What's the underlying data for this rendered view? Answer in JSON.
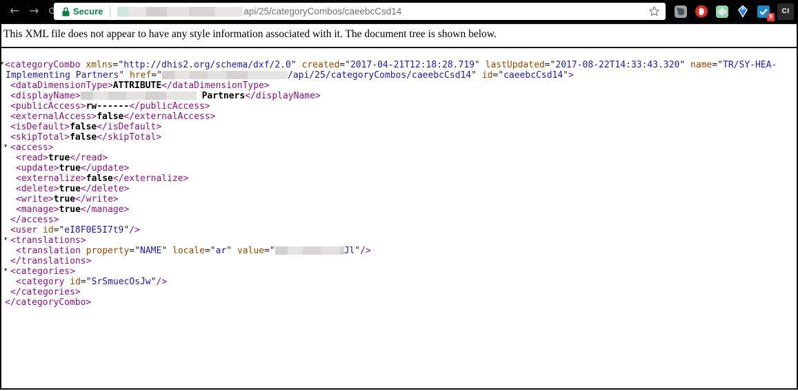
{
  "colors": {
    "tag": "#881280",
    "attr": "#994500",
    "value": "#1a1aa6",
    "green": "#0b8043",
    "red": "#e53935"
  },
  "browser": {
    "back_icon": "←",
    "forward_icon": "→",
    "reload_icon": "⟳",
    "security_label": "Secure",
    "url_path": "api/25/categoryCombos/caeebcCsd14",
    "star_icon": "bookmark-star",
    "extensions": [
      "evernote",
      "stop-hand",
      "audio-wave",
      "gem",
      "check-tasks"
    ],
    "notification_badge": "9",
    "profile_label": "CI"
  },
  "notice": "This XML file does not appear to have any style information associated with it. The document tree is shown below.",
  "xml": {
    "lines": [
      {
        "indent": 0,
        "arrow": true,
        "seg": [
          [
            "g",
            "<categoryCombo "
          ],
          [
            "a",
            "xmlns"
          ],
          [
            "p",
            "=\""
          ],
          [
            "v",
            "http://dhis2.org/schema/dxf/2.0"
          ],
          [
            "p",
            "\" "
          ],
          [
            "a",
            "created"
          ],
          [
            "p",
            "=\""
          ],
          [
            "v",
            "2017-04-21T12:18:28.719"
          ],
          [
            "p",
            "\" "
          ],
          [
            "a",
            "lastUpdated"
          ],
          [
            "p",
            "=\""
          ],
          [
            "v",
            "2017-08-22T14:33:43.320"
          ],
          [
            "p",
            "\" "
          ],
          [
            "a",
            "name"
          ],
          [
            "p",
            "=\""
          ],
          [
            "v",
            "TR/SY-HEA-"
          ]
        ]
      },
      {
        "indent": 0,
        "cont": true,
        "seg": [
          [
            "v",
            "Implementing Partners"
          ],
          [
            "p",
            "\" "
          ],
          [
            "a",
            "href"
          ],
          [
            "p",
            "=\""
          ],
          [
            "b",
            "182"
          ],
          [
            "v",
            "/api/25/categoryCombos/caeebcCsd14"
          ],
          [
            "p",
            "\" "
          ],
          [
            "a",
            "id"
          ],
          [
            "p",
            "=\""
          ],
          [
            "v",
            "caeebcCsd14"
          ],
          [
            "p",
            "\""
          ],
          [
            "g",
            ">"
          ]
        ]
      },
      {
        "indent": 1,
        "seg": [
          [
            "g",
            "<dataDimensionType>"
          ],
          [
            "x",
            "ATTRIBUTE"
          ],
          [
            "g",
            "</dataDimensionType>"
          ]
        ]
      },
      {
        "indent": 1,
        "seg": [
          [
            "g",
            "<displayName>"
          ],
          [
            "b",
            "168"
          ],
          [
            "x",
            " Partners"
          ],
          [
            "g",
            "</displayName>"
          ]
        ]
      },
      {
        "indent": 1,
        "seg": [
          [
            "g",
            "<publicAccess>"
          ],
          [
            "x",
            "rw------"
          ],
          [
            "g",
            "</publicAccess>"
          ]
        ]
      },
      {
        "indent": 1,
        "seg": [
          [
            "g",
            "<externalAccess>"
          ],
          [
            "x",
            "false"
          ],
          [
            "g",
            "</externalAccess>"
          ]
        ]
      },
      {
        "indent": 1,
        "seg": [
          [
            "g",
            "<isDefault>"
          ],
          [
            "x",
            "false"
          ],
          [
            "g",
            "</isDefault>"
          ]
        ]
      },
      {
        "indent": 1,
        "seg": [
          [
            "g",
            "<skipTotal>"
          ],
          [
            "x",
            "false"
          ],
          [
            "g",
            "</skipTotal>"
          ]
        ]
      },
      {
        "indent": 1,
        "arrow": true,
        "seg": [
          [
            "g",
            "<access>"
          ]
        ]
      },
      {
        "indent": 2,
        "seg": [
          [
            "g",
            "<read>"
          ],
          [
            "x",
            "true"
          ],
          [
            "g",
            "</read>"
          ]
        ]
      },
      {
        "indent": 2,
        "seg": [
          [
            "g",
            "<update>"
          ],
          [
            "x",
            "true"
          ],
          [
            "g",
            "</update>"
          ]
        ]
      },
      {
        "indent": 2,
        "seg": [
          [
            "g",
            "<externalize>"
          ],
          [
            "x",
            "false"
          ],
          [
            "g",
            "</externalize>"
          ]
        ]
      },
      {
        "indent": 2,
        "seg": [
          [
            "g",
            "<delete>"
          ],
          [
            "x",
            "true"
          ],
          [
            "g",
            "</delete>"
          ]
        ]
      },
      {
        "indent": 2,
        "seg": [
          [
            "g",
            "<write>"
          ],
          [
            "x",
            "true"
          ],
          [
            "g",
            "</write>"
          ]
        ]
      },
      {
        "indent": 2,
        "seg": [
          [
            "g",
            "<manage>"
          ],
          [
            "x",
            "true"
          ],
          [
            "g",
            "</manage>"
          ]
        ]
      },
      {
        "indent": 1,
        "seg": [
          [
            "g",
            "</access>"
          ]
        ]
      },
      {
        "indent": 1,
        "seg": [
          [
            "g",
            "<user "
          ],
          [
            "a",
            "id"
          ],
          [
            "p",
            "=\""
          ],
          [
            "v",
            "eI8F0E5I7t9"
          ],
          [
            "p",
            "\""
          ],
          [
            "g",
            "/>"
          ]
        ]
      },
      {
        "indent": 1,
        "arrow": true,
        "seg": [
          [
            "g",
            "<translations>"
          ]
        ]
      },
      {
        "indent": 2,
        "seg": [
          [
            "g",
            "<translation "
          ],
          [
            "a",
            "property"
          ],
          [
            "p",
            "=\""
          ],
          [
            "v",
            "NAME"
          ],
          [
            "p",
            "\" "
          ],
          [
            "a",
            "locale"
          ],
          [
            "p",
            "=\""
          ],
          [
            "v",
            "ar"
          ],
          [
            "p",
            "\" "
          ],
          [
            "a",
            "value"
          ],
          [
            "p",
            "=\""
          ],
          [
            "b",
            "100"
          ],
          [
            "v",
            "Jl"
          ],
          [
            "p",
            "\""
          ],
          [
            "g",
            "/>"
          ]
        ]
      },
      {
        "indent": 1,
        "seg": [
          [
            "g",
            "</translations>"
          ]
        ]
      },
      {
        "indent": 1,
        "arrow": true,
        "seg": [
          [
            "g",
            "<categories>"
          ]
        ]
      },
      {
        "indent": 2,
        "seg": [
          [
            "g",
            "<category "
          ],
          [
            "a",
            "id"
          ],
          [
            "p",
            "=\""
          ],
          [
            "v",
            "SrSmuecOsJw"
          ],
          [
            "p",
            "\""
          ],
          [
            "g",
            "/>"
          ]
        ]
      },
      {
        "indent": 1,
        "seg": [
          [
            "g",
            "</categories>"
          ]
        ]
      },
      {
        "indent": 0,
        "seg": [
          [
            "g",
            "</categoryCombo>"
          ]
        ]
      }
    ]
  }
}
